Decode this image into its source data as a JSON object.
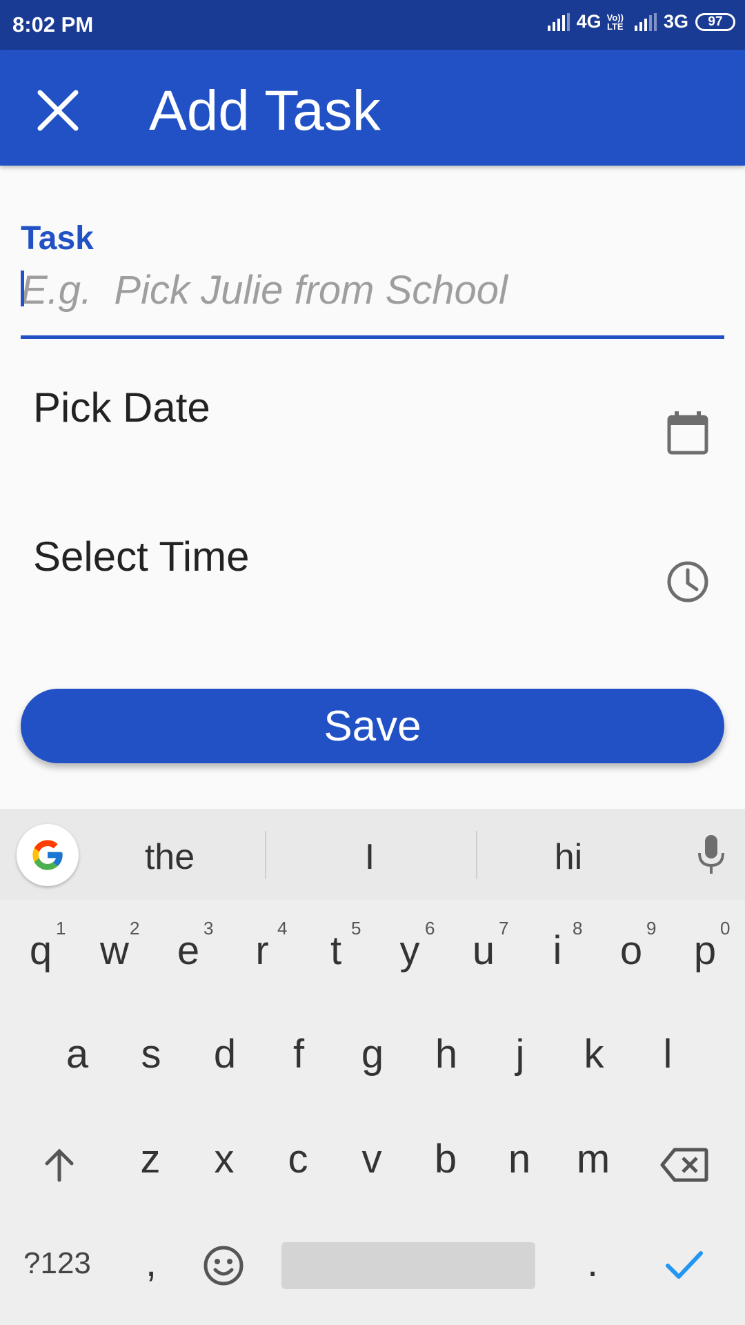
{
  "status_bar": {
    "time": "8:02 PM",
    "network_1": "4G",
    "volte_top": "Vo))",
    "volte_bottom": "LTE",
    "network_2": "3G",
    "battery": "97"
  },
  "app_bar": {
    "title": "Add Task",
    "close_icon": "close-icon"
  },
  "form": {
    "task_label": "Task",
    "task_value": "",
    "task_placeholder": "E.g.  Pick Julie from School",
    "pick_date_label": "Pick Date",
    "select_time_label": "Select Time",
    "save_label": "Save"
  },
  "keyboard": {
    "suggestions": [
      "the",
      "I",
      "hi"
    ],
    "row1": [
      {
        "key": "q",
        "hint": "1"
      },
      {
        "key": "w",
        "hint": "2"
      },
      {
        "key": "e",
        "hint": "3"
      },
      {
        "key": "r",
        "hint": "4"
      },
      {
        "key": "t",
        "hint": "5"
      },
      {
        "key": "y",
        "hint": "6"
      },
      {
        "key": "u",
        "hint": "7"
      },
      {
        "key": "i",
        "hint": "8"
      },
      {
        "key": "o",
        "hint": "9"
      },
      {
        "key": "p",
        "hint": "0"
      }
    ],
    "row2": [
      "a",
      "s",
      "d",
      "f",
      "g",
      "h",
      "j",
      "k",
      "l"
    ],
    "row3": [
      "z",
      "x",
      "c",
      "v",
      "b",
      "n",
      "m"
    ],
    "symbols_key": "?123",
    "comma_key": ",",
    "period_key": "."
  },
  "colors": {
    "primary": "#2251c5",
    "status_bar": "#1a3b94",
    "enter_check": "#2196f3"
  }
}
